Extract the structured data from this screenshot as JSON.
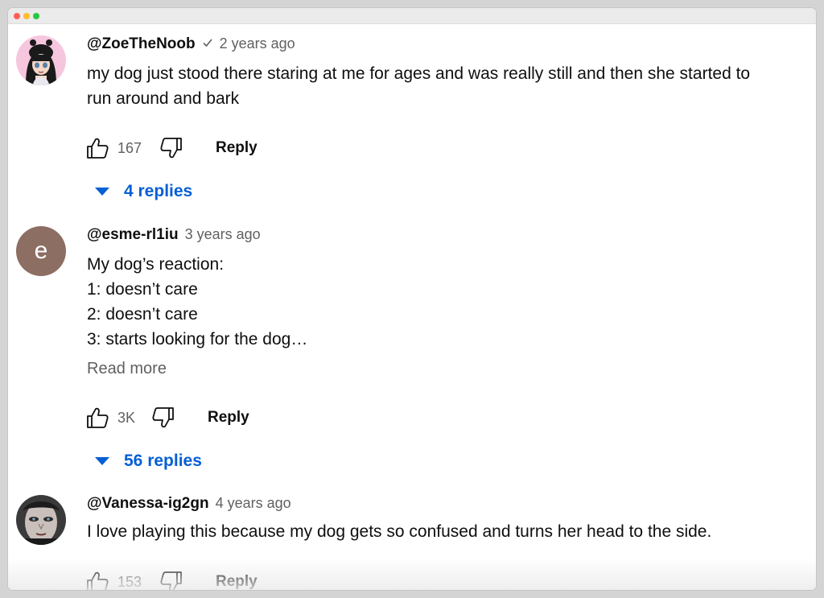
{
  "comments": [
    {
      "author": "@ZoeTheNoob",
      "verified": true,
      "time": "2 years ago",
      "text": "my dog just stood there staring at me for ages and was really still and then she started to run around and bark",
      "likes": "167",
      "reply_label": "Reply",
      "replies_label": "4 replies",
      "avatar_icon": "anime-girl-avatar"
    },
    {
      "author": "@esme-rl1iu",
      "time": "3 years ago",
      "avatar_letter": "e",
      "text_lines": [
        "My dog’s reaction:",
        "1: doesn’t care",
        "2: doesn’t care",
        "3: starts looking for the dog…"
      ],
      "read_more": "Read more",
      "likes": "3K",
      "reply_label": "Reply",
      "replies_label": "56 replies"
    },
    {
      "author": "@Vanessa-ig2gn",
      "time": "4 years ago",
      "text": "I love playing this because my dog gets so confused and turns her head to the side.",
      "likes": "153",
      "reply_label": "Reply",
      "avatar_icon": "face-photo-avatar"
    }
  ],
  "colors": {
    "link_blue": "#065fd4",
    "secondary_text": "#606060",
    "avatar_letter_bg": "#8d6e63"
  }
}
